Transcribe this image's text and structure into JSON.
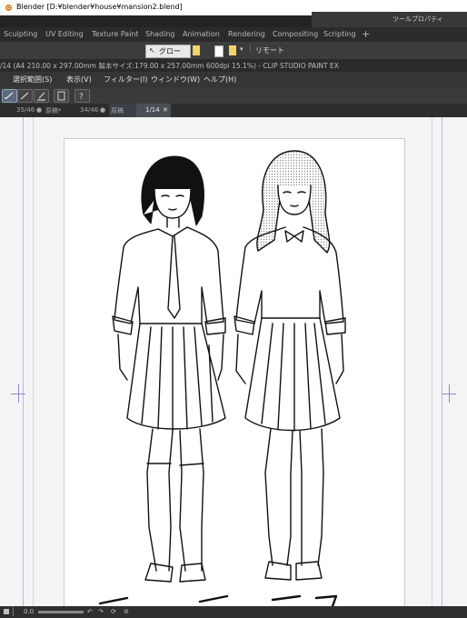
{
  "blender": {
    "title": "Blender [D:¥blender¥house¥mansion2.blend]",
    "workspace_tabs": [
      "Sculpting",
      "UV Editing",
      "Texture Paint",
      "Shading",
      "Animation",
      "Rendering",
      "Compositing",
      "Scripting"
    ],
    "add_tab": "+"
  },
  "csp": {
    "tool_property_title": "ツールプロパティ",
    "toolbar": {
      "layer_label": "グロー",
      "remote_label": "リモート"
    },
    "info_text": "/14 (A4 210.00 x 297.00mm 製本サイズ:179.00 x 257.00mm 600dpi 15.1%) - CLIP STUDIO PAINT EX",
    "menu": [
      "選択範囲(S)",
      "表示(V)",
      "フィルター(I)",
      "ウィンドウ(W)",
      "ヘルプ(H)"
    ],
    "doc_tabs": [
      {
        "label": "35/46",
        "dot": "●"
      },
      {
        "label": "原稿*",
        "dot": ""
      },
      {
        "label": "34/46",
        "dot": "●"
      },
      {
        "label": "原稿",
        "dot": ""
      },
      {
        "label": "1/14",
        "close": "✕"
      }
    ],
    "status": {
      "zoom": "0.0"
    }
  },
  "colors": {
    "blender_bg": "#232323",
    "csp_panel": "#3c3c3c",
    "canvas_bg": "#f4f4f4",
    "guide": "#8a8ad0"
  }
}
